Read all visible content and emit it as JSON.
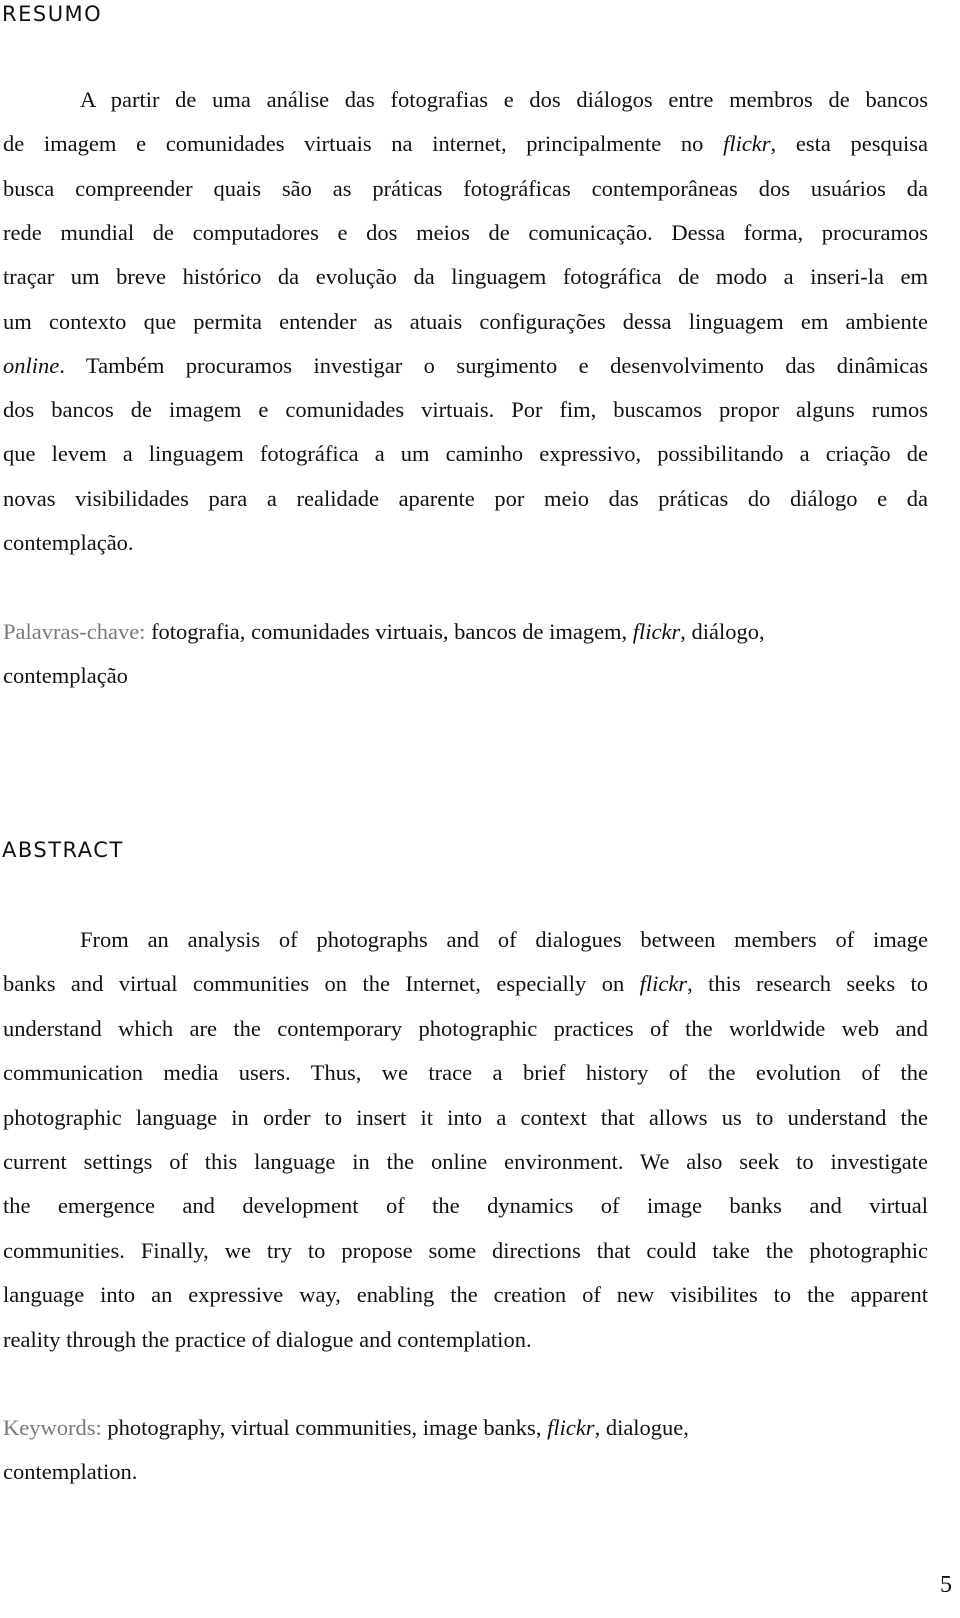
{
  "resumo": {
    "heading": "RESUMO",
    "lines": [
      "A partir de uma análise das fotografias e dos diálogos entre membros de bancos",
      [
        "de imagem e comunidades virtuais na internet, principalmente no ",
        "flickr",
        ", esta pesquisa"
      ],
      "busca compreender quais são as práticas fotográficas contemporâneas dos usuários da",
      "rede mundial de computadores e dos meios de comunicação. Dessa forma, procuramos",
      "traçar um breve histórico da evolução da linguagem fotográfica de modo a inseri-la em",
      "um contexto que permita entender as atuais configurações dessa linguagem em ambiente",
      [
        "",
        "online",
        ". Também procuramos investigar o surgimento e desenvolvimento das dinâmicas"
      ],
      "dos bancos de imagem e comunidades virtuais. Por fim, buscamos propor alguns rumos",
      "que levem a linguagem fotográfica a um caminho expressivo, possibilitando a criação de",
      "novas visibilidades para a realidade aparente por meio das práticas do diálogo e da",
      "contemplação."
    ],
    "keywords_label": "Palavras-chave:",
    "keywords_line1": [
      " fotografia, comunidades virtuais, bancos de imagem, ",
      "flickr",
      ", diálogo,"
    ],
    "keywords_line2": "contemplação"
  },
  "abstract": {
    "heading": "ABSTRACT",
    "lines": [
      "From an analysis of photographs and of dialogues between members of image",
      [
        "banks and virtual communities on the Internet, especially on ",
        "flickr",
        ", this research seeks to"
      ],
      "understand which are the contemporary photographic practices of the worldwide web and",
      "communication media users. Thus, we trace a brief history of the evolution of the",
      "photographic language in order to insert it into a context that allows us to understand the",
      "current settings of this language in the online environment. We also seek to investigate",
      "the emergence and development of the dynamics of image banks and virtual",
      "communities. Finally, we try to propose some directions that could take the photographic",
      "language into an expressive way, enabling the creation of new visibilites to the apparent",
      "reality through the practice of dialogue and contemplation."
    ],
    "keywords_label": "Keywords:",
    "keywords_line1": [
      " photography, virtual communities, image banks, ",
      " flickr",
      ", dialogue,"
    ],
    "keywords_line2": "contemplation."
  },
  "page_number": "5",
  "colors": {
    "text": "#111111",
    "keyword_label": "#7a7a7a"
  }
}
